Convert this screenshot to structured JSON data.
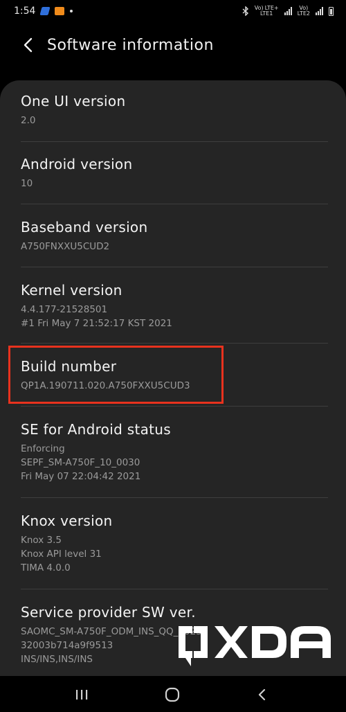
{
  "status_bar": {
    "time": "1:54",
    "sim1_top": "Vo)",
    "sim1_top2": "LTE+",
    "sim1_bottom": "LTE1",
    "sim2_top": "Vo)",
    "sim2_bottom": "LTE2",
    "icons": [
      "notification-app-icon",
      "notification-app-icon",
      "dot-icon",
      "bluetooth-icon",
      "signal-icon",
      "battery-icon"
    ]
  },
  "header": {
    "title": "Software information",
    "back_icon": "back-arrow-icon"
  },
  "items": [
    {
      "title": "One UI version",
      "lines": [
        "2.0"
      ]
    },
    {
      "title": "Android version",
      "lines": [
        "10"
      ]
    },
    {
      "title": "Baseband version",
      "lines": [
        "A750FNXXU5CUD2"
      ]
    },
    {
      "title": "Kernel version",
      "lines": [
        "4.4.177-21528501",
        "#1 Fri May 7 21:52:17 KST 2021"
      ]
    },
    {
      "title": "Build number",
      "lines": [
        "QP1A.190711.020.A750FXXU5CUD3"
      ]
    },
    {
      "title": "SE for Android status",
      "lines": [
        "Enforcing",
        "SEPF_SM-A750F_10_0030",
        "Fri May 07 22:04:42 2021"
      ]
    },
    {
      "title": "Knox version",
      "lines": [
        "Knox 3.5",
        "Knox API level 31",
        "TIMA 4.0.0"
      ]
    },
    {
      "title": "Service provider SW ver.",
      "lines": [
        "SAOMC_SM-A750F_ODM_INS_QQ_0023",
        "32003b714a9f9513",
        "INS/INS,INS/INS"
      ]
    }
  ],
  "colors": {
    "background": "#000000",
    "card": "#252525",
    "highlight": "#e8321e",
    "secondary_text": "#9b9b9b"
  },
  "watermark": {
    "brand": "XDA",
    "icon": "xda-logo"
  },
  "nav_bar": {
    "icons": [
      "recent-apps-icon",
      "home-icon",
      "back-icon"
    ]
  }
}
